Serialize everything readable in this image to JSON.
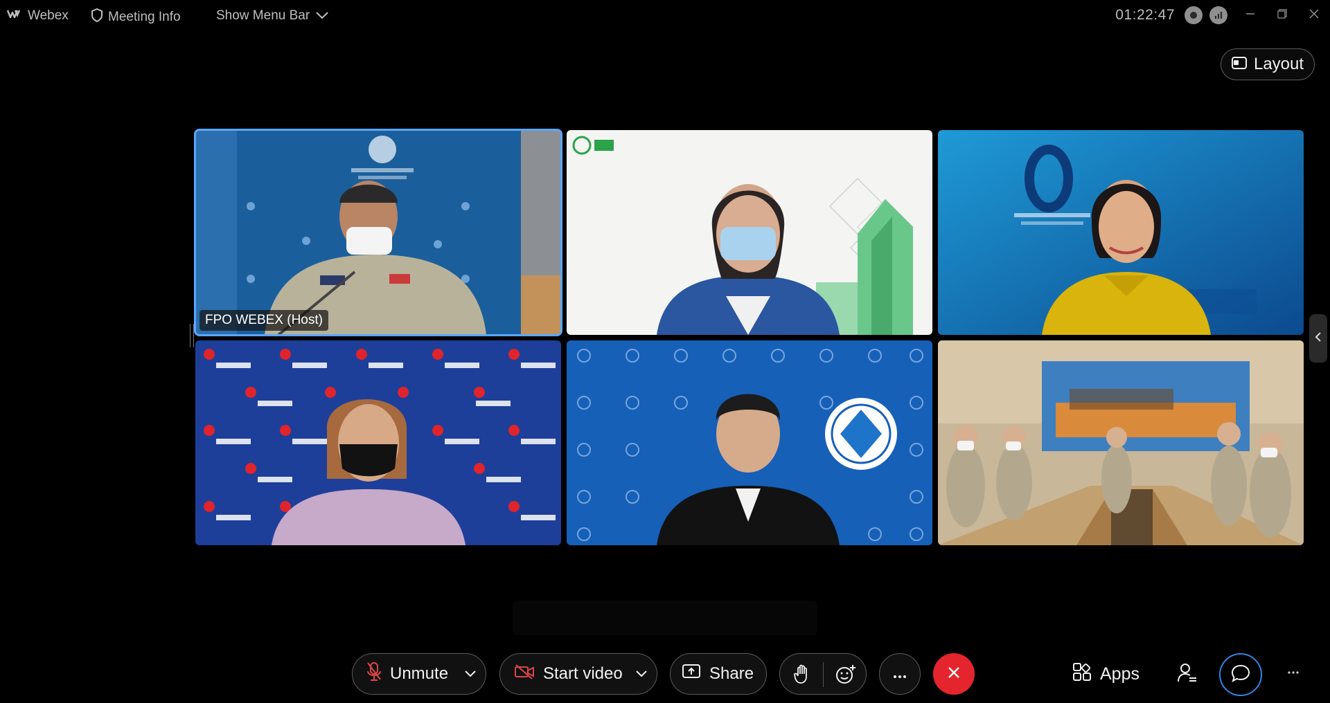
{
  "topbar": {
    "app_name": "Webex",
    "meeting_info": "Meeting Info",
    "show_menu_bar": "Show Menu Bar",
    "timer": "01:22:47"
  },
  "layout_button": {
    "label": "Layout"
  },
  "participants": [
    {
      "id": "tile-1",
      "name_label": "FPO WEBEX (Host)",
      "active_speaker": true
    }
  ],
  "controls": {
    "unmute": "Unmute",
    "start_video": "Start video",
    "share": "Share",
    "apps": "Apps"
  },
  "colors": {
    "background": "#000000",
    "active_border": "#5aa7ff",
    "leave_red": "#e5252d",
    "chat_ring": "#2f86e6"
  },
  "icons": [
    "webex-logo-icon",
    "shield-icon",
    "chevron-down-icon",
    "record-icon",
    "signal-icon",
    "minimize-icon",
    "restore-icon",
    "close-icon",
    "layout-icon",
    "mic-off-icon",
    "video-off-icon",
    "share-icon",
    "raise-hand-icon",
    "reactions-icon",
    "more-icon",
    "leave-icon",
    "apps-icon",
    "participants-icon",
    "chat-icon",
    "chevron-left-icon"
  ]
}
